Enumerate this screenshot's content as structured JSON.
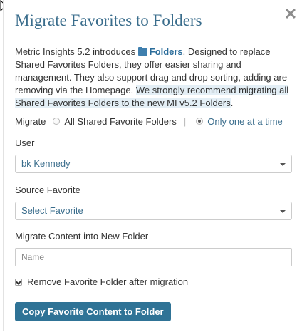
{
  "dialog": {
    "title": "Migrate Favorites to Folders",
    "close_icon": "close-icon"
  },
  "intro": {
    "part1": "Metric Insights 5.2 introduces ",
    "folders_icon": "folder-icon",
    "folders_word": "Folders",
    "part2": ". Designed to replace Shared Favorites Folders, they offer easier sharing and management. They also support drag and drop sorting, adding are removing via the Homepage. ",
    "highlight": "We strongly recommend migrating all Shared Favorites Folders to the new MI v5.2 Folders",
    "end": "."
  },
  "migrate": {
    "label": "Migrate",
    "options": [
      "All Shared Favorite Folders",
      "Only one at a time"
    ],
    "separator": "|",
    "selected": "Only one at a time"
  },
  "user": {
    "label": "User",
    "value": "bk Kennedy"
  },
  "source_favorite": {
    "label": "Source Favorite",
    "value": "Select Favorite"
  },
  "new_folder": {
    "label": "Migrate Content into New Folder",
    "placeholder": "Name"
  },
  "remove_after": {
    "label": "Remove Favorite Folder after migration",
    "checked": true
  },
  "submit": {
    "label": "Copy Favorite Content to Folder",
    "color": "#2f7396"
  },
  "colors": {
    "title": "#3a6d8c",
    "highlight": "#e4eff6"
  }
}
